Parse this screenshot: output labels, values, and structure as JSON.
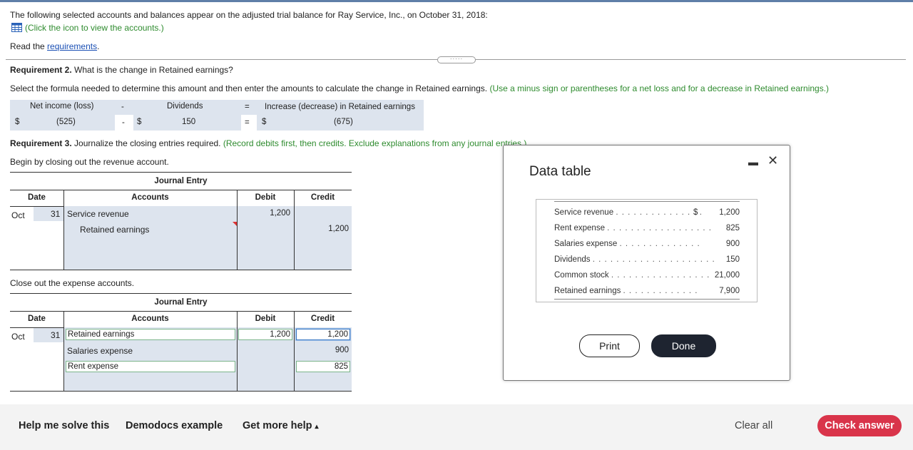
{
  "intro": {
    "text": "The following selected accounts and balances appear on the adjusted trial balance for Ray Service, Inc., on October 31, 2018:",
    "icon_link": "(Click the icon to view the accounts.)",
    "read_prefix": "Read the",
    "requirements_link": "requirements",
    "read_suffix": "."
  },
  "req2": {
    "label": "Requirement 2.",
    "question": "What is the change in Retained earnings?",
    "instruction": "Select the formula needed to determine this amount and then enter the amounts to calculate the change in Retained earnings.",
    "hint": "(Use a minus sign or parentheses for a net loss and for a decrease in Retained earnings.)",
    "formula": {
      "col1": "Net income (loss)",
      "op1": "-",
      "col2": "Dividends",
      "eq": "=",
      "col3": "Increase (decrease) in Retained earnings",
      "dollar": "$",
      "val1": "(525)",
      "op1b": "-",
      "val2": "150",
      "eq2": "=",
      "val3": "(675)"
    }
  },
  "req3": {
    "label": "Requirement 3.",
    "text": "Journalize the closing entries required.",
    "hint": "(Record debits first, then credits. Exclude explanations from any journal entries.)",
    "step1": "Begin by closing out the revenue account.",
    "step2": "Close out the expense accounts."
  },
  "journal": {
    "title": "Journal Entry",
    "headers": {
      "date": "Date",
      "accounts": "Accounts",
      "debit": "Debit",
      "credit": "Credit"
    },
    "entry1": {
      "month": "Oct",
      "day": "31",
      "rows": [
        {
          "account": "Service revenue",
          "debit": "1,200",
          "credit": ""
        },
        {
          "account": "Retained earnings",
          "debit": "",
          "credit": "1,200"
        }
      ]
    },
    "entry2": {
      "month": "Oct",
      "day": "31",
      "rows": [
        {
          "account": "Retained earnings",
          "debit": "1,200",
          "credit": "1,200"
        },
        {
          "account": "Salaries expense",
          "debit": "",
          "credit": "900"
        },
        {
          "account": "Rent expense",
          "debit": "",
          "credit": "825"
        }
      ]
    }
  },
  "modal": {
    "title": "Data table",
    "minimize": "▬",
    "close": "✕",
    "rows": [
      {
        "label": "Service revenue",
        "dots": ". . . . . . . . . . . . . . .",
        "dollar": "$",
        "value": "1,200"
      },
      {
        "label": "Rent expense",
        "dots": ". . . . . . . . . . . . . . . . . .",
        "dollar": "",
        "value": "825"
      },
      {
        "label": "Salaries expense",
        "dots": ". . . . . . . . . . . . . .",
        "dollar": "",
        "value": "900"
      },
      {
        "label": "Dividends",
        "dots": ". . . . . . . . . . . . . . . . . . . . .",
        "dollar": "",
        "value": "150"
      },
      {
        "label": "Common stock",
        "dots": ". . . . . . . . . . . . . . . . .",
        "dollar": "",
        "value": "21,000"
      },
      {
        "label": "Retained earnings",
        "dots": ". . . . . . . . . . . . .",
        "dollar": "",
        "value": "7,900"
      }
    ],
    "print": "Print",
    "done": "Done"
  },
  "footer": {
    "help": "Help me solve this",
    "demo": "Demodocs example",
    "more": "Get more help",
    "more_caret": "▴",
    "clear": "Clear all",
    "check": "Check answer"
  },
  "colors": {
    "accent_blue": "#1a4fb4",
    "green_hint": "#2e8b2e",
    "check_red": "#d9344a",
    "done_dark": "#1e2430",
    "table_fill": "#dde4ee"
  }
}
